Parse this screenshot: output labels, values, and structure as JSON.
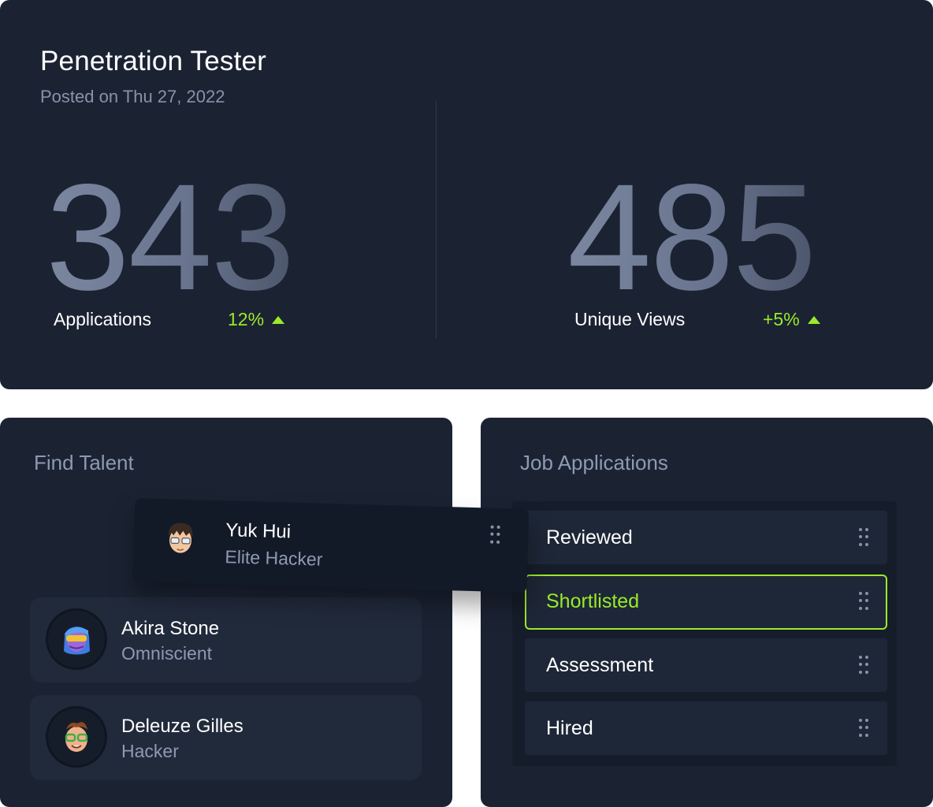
{
  "job": {
    "title": "Penetration Tester",
    "posted": "Posted on Thu 27, 2022"
  },
  "metrics": {
    "applications": {
      "value": "343",
      "label": "Applications",
      "change": "12%"
    },
    "views": {
      "value": "485",
      "label": "Unique Views",
      "change": "+5%"
    }
  },
  "talent": {
    "title": "Find Talent",
    "dragging": {
      "name": "Yuk Hui",
      "role": "Elite Hacker"
    },
    "items": [
      {
        "name": "Akira Stone",
        "role": "Omniscient"
      },
      {
        "name": "Deleuze Gilles",
        "role": "Hacker"
      }
    ]
  },
  "jobs": {
    "title": "Job Applications",
    "stages": [
      "Reviewed",
      "Shortlisted",
      "Assessment",
      "Hired"
    ],
    "active_stage": "Shortlisted"
  },
  "colors": {
    "background_card": "#1b2333",
    "accent_green": "#9aea2a",
    "muted_text": "#8d9ab3"
  }
}
